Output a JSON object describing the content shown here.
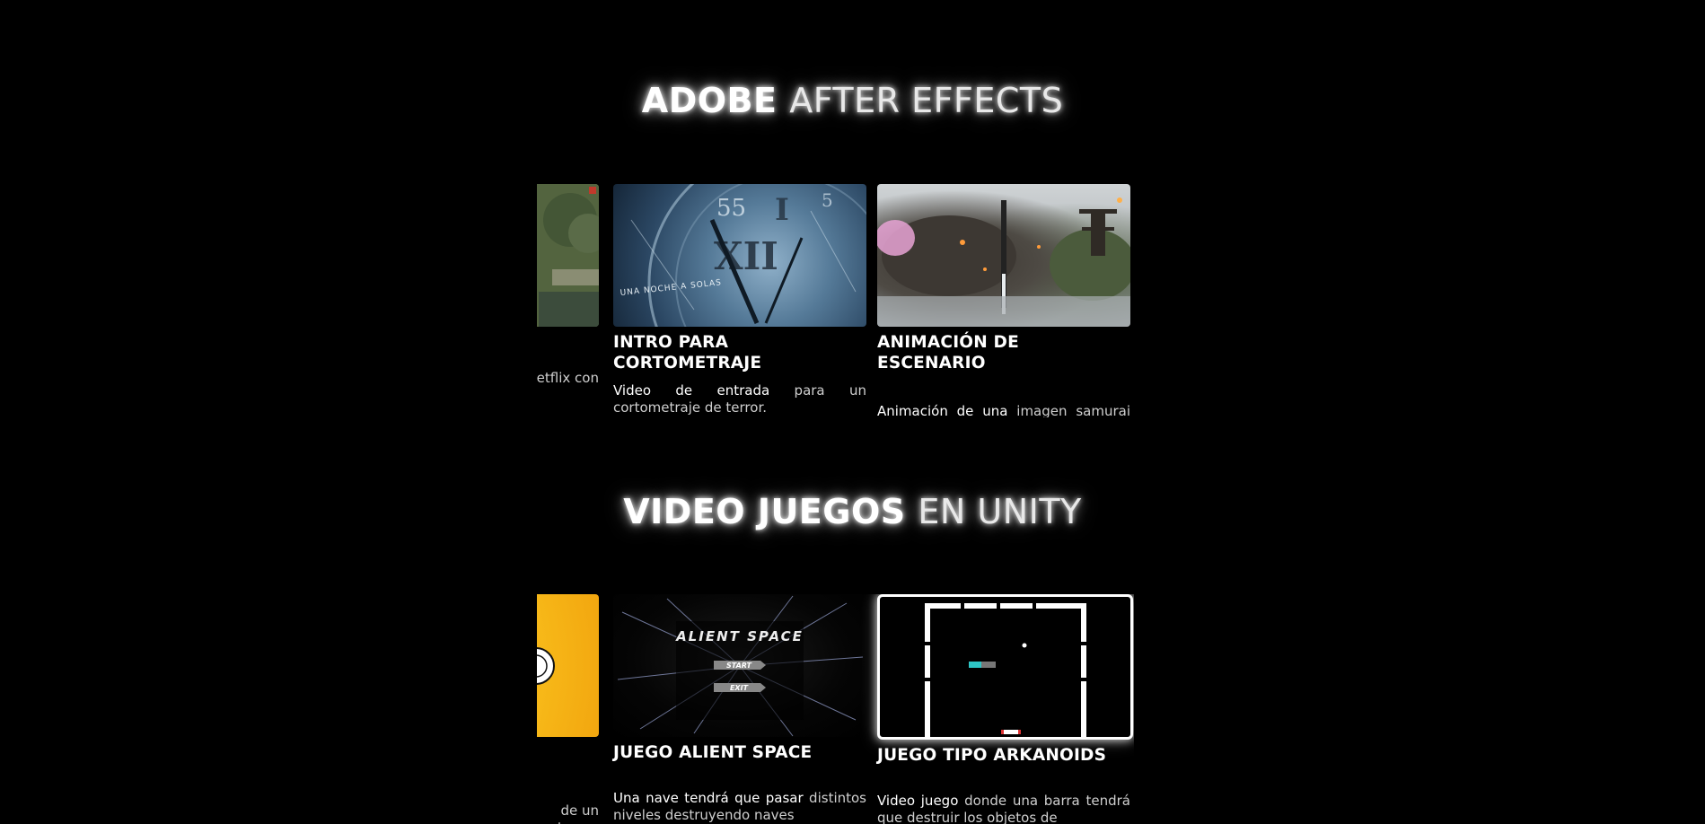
{
  "sections": [
    {
      "title_bold": "ADOBE",
      "title_light": "AFTER EFFECTS",
      "cards": [
        {
          "title": "",
          "desc_hl": "",
          "desc_rest": "letflix con"
        },
        {
          "title": "INTRO PARA CORTOMETRAJE",
          "desc_hl": "Video de entrada",
          "desc_rest": " para un cortometraje de terror.",
          "thumb_text": "UNA NOCHE A SOLAS"
        },
        {
          "title": "ANIMACIÓN DE ESCENARIO",
          "desc_hl": "Animación de una",
          "desc_rest": " imagen samurai estática."
        }
      ]
    },
    {
      "title_bold": "VIDEO JUEGOS",
      "title_light": "EN UNITY",
      "cards": [
        {
          "title": "",
          "desc_hl": "",
          "desc_rest": "de un\ne atrapar"
        },
        {
          "title": "JUEGO ALIENT SPACE",
          "desc_hl": "Una nave tendrá que pasar",
          "desc_rest": " distintos niveles destruyendo naves",
          "thumb_title": "ALIENT SPACE",
          "thumb_btn1": "START",
          "thumb_btn2": "EXIT"
        },
        {
          "title": "JUEGO TIPO ARKANOIDS",
          "desc_hl": "Video juego",
          "desc_rest": " donde una barra tendrá que destruir los objetos de"
        }
      ]
    }
  ]
}
